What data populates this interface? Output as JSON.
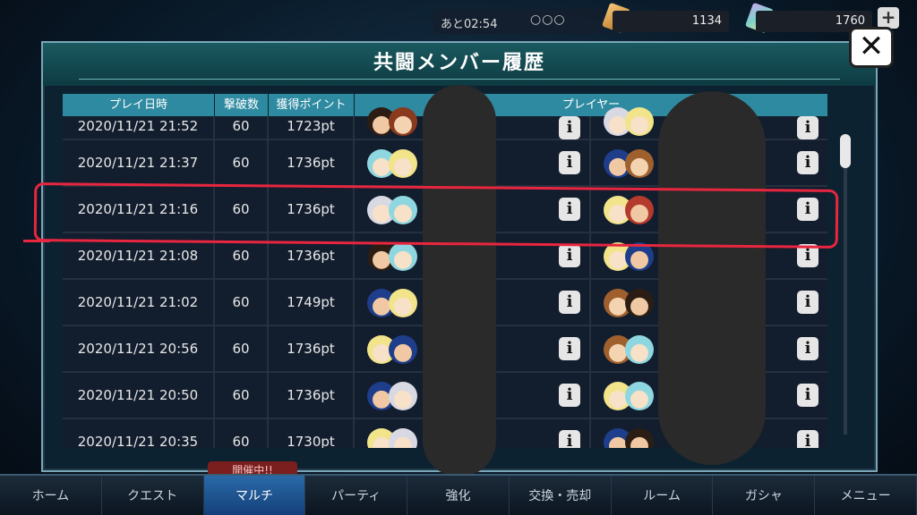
{
  "topbar": {
    "timer": "あと02:54",
    "dots": "○○○",
    "resource1": "1134",
    "resource2": "1760",
    "plus": "+"
  },
  "dialog": {
    "title": "共闘メンバー履歴",
    "close": "✕"
  },
  "table": {
    "headers": [
      "プレイ日時",
      "撃破数",
      "獲得ポイント",
      "プレイヤー"
    ],
    "rows": [
      {
        "date": "2020/11/21 21:52",
        "kills": "60",
        "points": "1723pt",
        "p1": [
          "dark",
          "brown"
        ],
        "p2": [
          "white",
          "blonde"
        ]
      },
      {
        "date": "2020/11/21 21:37",
        "kills": "60",
        "points": "1736pt",
        "p1": [
          "cyan",
          "blonde"
        ],
        "p2": [
          "navy",
          "auburn"
        ]
      },
      {
        "date": "2020/11/21 21:16",
        "kills": "60",
        "points": "1736pt",
        "p1": [
          "white",
          "cyan"
        ],
        "p2": [
          "blonde",
          "red"
        ]
      },
      {
        "date": "2020/11/21 21:08",
        "kills": "60",
        "points": "1736pt",
        "p1": [
          "dark",
          "cyan"
        ],
        "p2": [
          "blonde",
          "navy"
        ]
      },
      {
        "date": "2020/11/21 21:02",
        "kills": "60",
        "points": "1749pt",
        "p1": [
          "navy",
          "blonde"
        ],
        "p2": [
          "auburn",
          "dark"
        ]
      },
      {
        "date": "2020/11/21 20:56",
        "kills": "60",
        "points": "1736pt",
        "p1": [
          "blonde",
          "navy"
        ],
        "p2": [
          "auburn",
          "cyan"
        ]
      },
      {
        "date": "2020/11/21 20:50",
        "kills": "60",
        "points": "1736pt",
        "p1": [
          "navy",
          "white"
        ],
        "p2": [
          "blonde",
          "cyan"
        ]
      },
      {
        "date": "2020/11/21 20:35",
        "kills": "60",
        "points": "1730pt",
        "p1": [
          "blonde",
          "white"
        ],
        "p2": [
          "navy",
          "dark"
        ]
      }
    ],
    "info_label": "i"
  },
  "nav": {
    "items": [
      "ホーム",
      "クエスト",
      "マルチ",
      "パーティ",
      "強化",
      "交換・売却",
      "ルーム",
      "ガシャ",
      "メニュー"
    ],
    "active_index": 2,
    "badge": "開催中!!"
  },
  "colors": {
    "accent": "#2e8aa0",
    "highlight": "#e8263f"
  }
}
